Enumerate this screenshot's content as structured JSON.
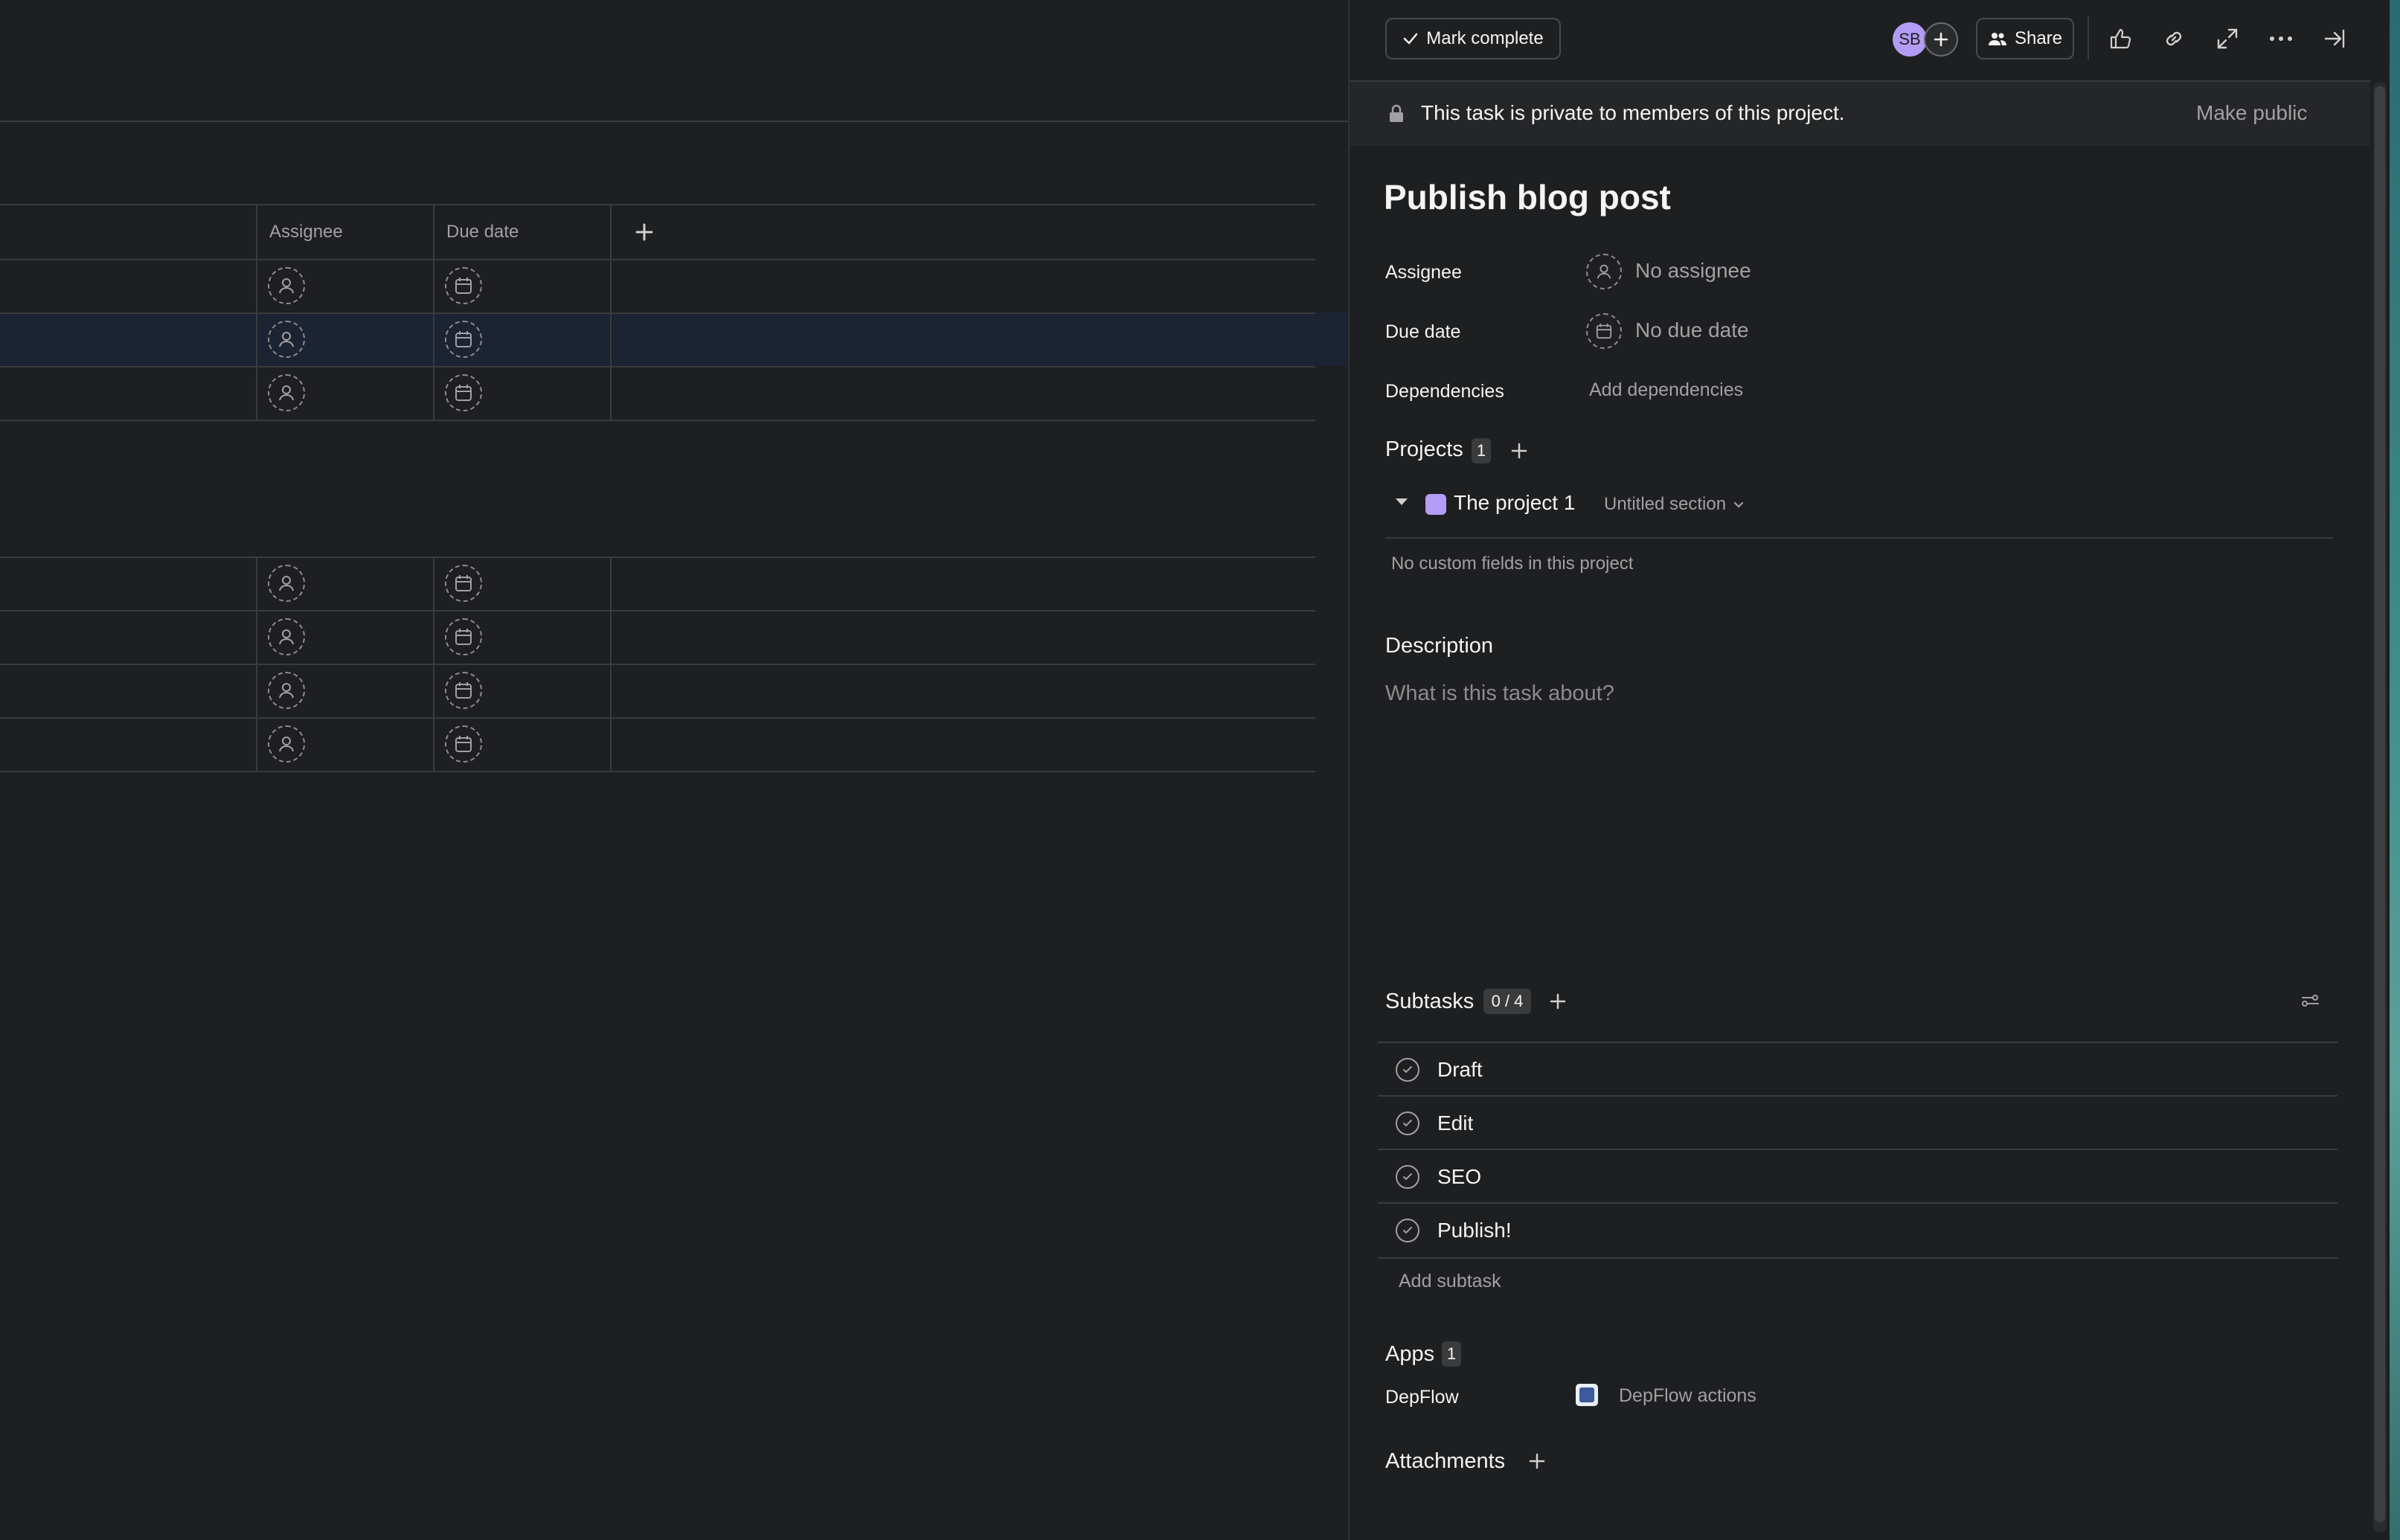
{
  "list": {
    "columns": {
      "assignee": "Assignee",
      "due_date": "Due date"
    },
    "rows_group1": 3,
    "rows_group2": 4
  },
  "task": {
    "mark_complete": "Mark complete",
    "collaborator_initials": "SB",
    "share": "Share",
    "privacy_notice": "This task is private to members of this project.",
    "make_public": "Make public",
    "title": "Publish blog post",
    "fields": {
      "assignee_label": "Assignee",
      "assignee_value": "No assignee",
      "due_date_label": "Due date",
      "due_date_value": "No due date",
      "dependencies_label": "Dependencies",
      "dependencies_value": "Add dependencies"
    },
    "projects": {
      "label": "Projects",
      "count": "1",
      "project_name": "The project 1",
      "section": "Untitled section",
      "no_custom_fields": "No custom fields in this project",
      "project_color": "#b39cf5"
    },
    "description": {
      "label": "Description",
      "placeholder": "What is this task about?"
    },
    "subtasks": {
      "label": "Subtasks",
      "count": "0 / 4",
      "items": [
        {
          "name": "Draft"
        },
        {
          "name": "Edit"
        },
        {
          "name": "SEO"
        },
        {
          "name": "Publish!"
        }
      ],
      "add_label": "Add subtask"
    },
    "apps": {
      "label": "Apps",
      "count": "1",
      "app_name": "DepFlow",
      "app_action": "DepFlow actions"
    },
    "attachments": {
      "label": "Attachments"
    }
  },
  "colors": {
    "background": "#1e1f21",
    "row_highlight": "#1c2333",
    "avatar": "#b39cf5",
    "text": "#f5f4f3",
    "muted": "#a2a0a2"
  }
}
